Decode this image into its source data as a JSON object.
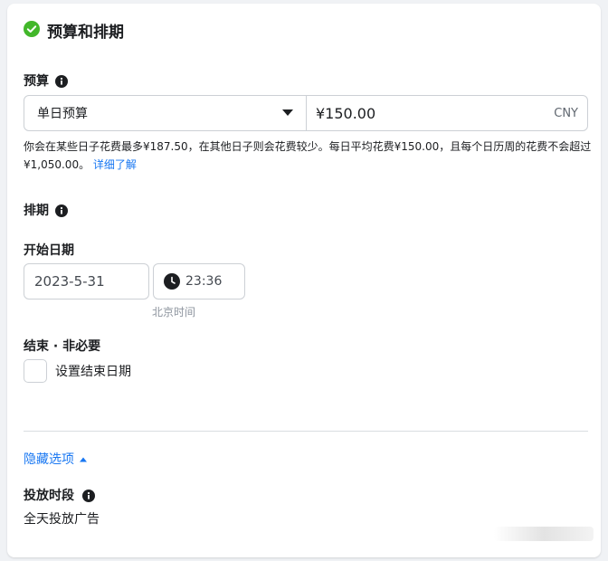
{
  "section": {
    "title": "预算和排期",
    "icon": "check-circle-icon",
    "accent_color": "#42b72a"
  },
  "budget": {
    "label": "预算",
    "type_selected": "单日预算",
    "amount": "¥150.00",
    "currency": "CNY",
    "note": "你会在某些日子花费最多¥187.50，在其他日子则会花费较少。每日平均花费¥150.00，且每个日历周的花费不会超过¥1,050.00。",
    "learn_more": "详细了解"
  },
  "schedule": {
    "label": "排期",
    "start_label": "开始日期",
    "start_date": "2023-5-31",
    "start_time": "23:36",
    "timezone": "北京时间",
    "end_label": "结束 · 非必要",
    "set_end_label": "设置结束日期"
  },
  "advanced": {
    "toggle_label": "隐藏选项",
    "delivery_label": "投放时段",
    "delivery_value": "全天投放广告"
  },
  "colors": {
    "link": "#1877f2",
    "border": "#ccd0d5"
  }
}
